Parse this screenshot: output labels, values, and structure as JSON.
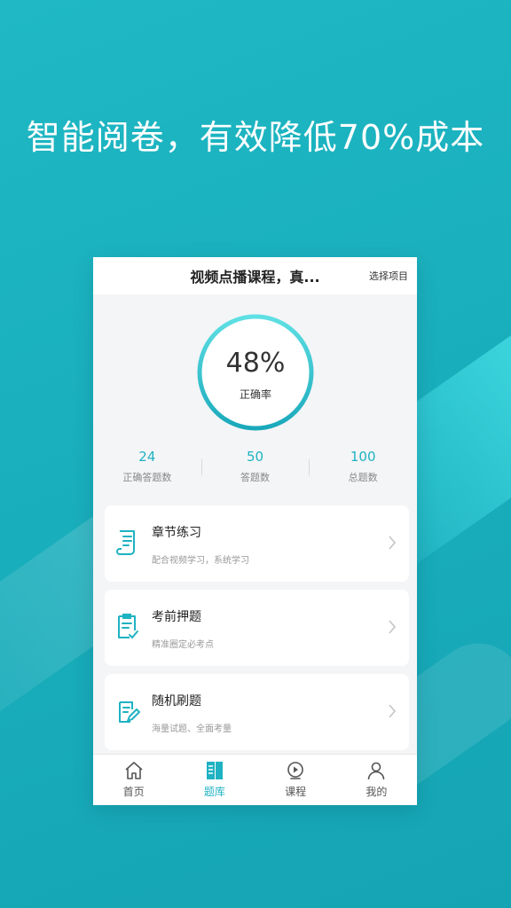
{
  "headline": "智能阅卷，有效降低70%成本",
  "header": {
    "title": "视频点播课程，真...",
    "action": "选择项目"
  },
  "accuracy": {
    "percent_text": "48%",
    "label": "正确率",
    "fraction": 0.48
  },
  "stats": [
    {
      "value": "24",
      "label": "正确答题数"
    },
    {
      "value": "50",
      "label": "答题数"
    },
    {
      "value": "100",
      "label": "总题数"
    }
  ],
  "menu": [
    {
      "title": "章节练习",
      "subtitle": "配合视频学习，系统学习",
      "icon": "chapter-scroll-icon"
    },
    {
      "title": "考前押题",
      "subtitle": "精准圈定必考点",
      "icon": "exam-checklist-icon"
    },
    {
      "title": "随机刷题",
      "subtitle": "海量试题、全面考量",
      "icon": "random-edit-icon"
    }
  ],
  "tabs": [
    {
      "label": "首页",
      "icon": "home-icon",
      "active": false
    },
    {
      "label": "题库",
      "icon": "book-icon",
      "active": true
    },
    {
      "label": "课程",
      "icon": "play-icon",
      "active": false
    },
    {
      "label": "我的",
      "icon": "user-icon",
      "active": false
    }
  ],
  "colors": {
    "accent": "#1fb2c2",
    "background": "#19aebc"
  }
}
